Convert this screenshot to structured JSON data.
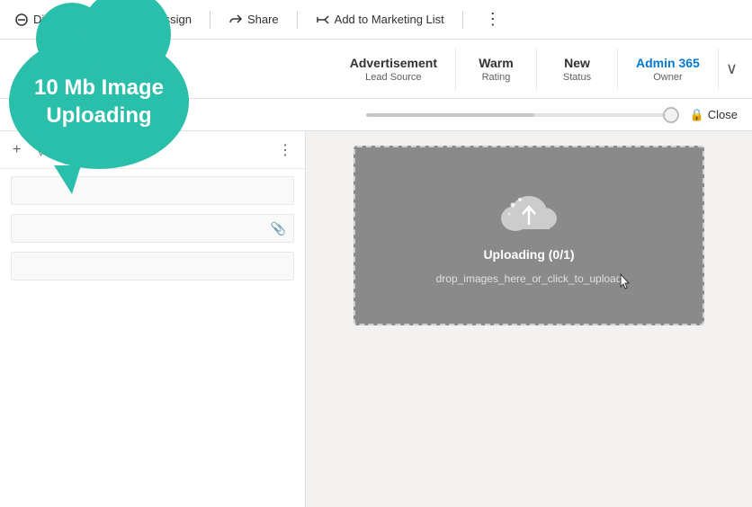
{
  "toolbar": {
    "disqualify_label": "Disqualif...",
    "assign_label": "Assign",
    "share_label": "Share",
    "add_to_marketing_label": "Add to Marketing List",
    "more_icon": "⋮"
  },
  "header": {
    "fields": [
      {
        "value": "Advertisement",
        "label": "Lead Source"
      },
      {
        "value": "Warm",
        "label": "Rating"
      },
      {
        "value": "New",
        "label": "Status"
      },
      {
        "value": "Admin 365",
        "label": "Owner",
        "blue": true
      }
    ],
    "chevron": "∨"
  },
  "progress": {
    "close_label": "Close",
    "lock_icon": "🔒"
  },
  "cloud_tooltip": {
    "line1": "10 Mb Image",
    "line2": "Uploading"
  },
  "left_panel": {
    "toolbar_icons": [
      "+",
      "▽",
      "≡",
      "⋮"
    ]
  },
  "upload_box": {
    "uploading_label": "Uploading (0/1)",
    "drop_label": "drop_images_here_or_click_to_upload"
  }
}
